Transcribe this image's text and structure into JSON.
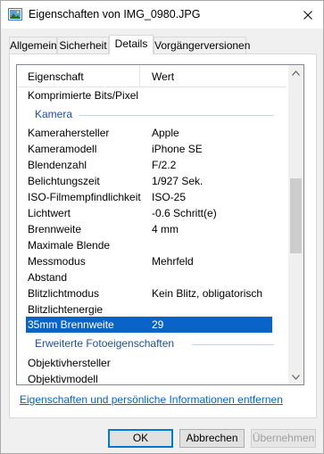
{
  "window": {
    "title": "Eigenschaften von IMG_0980.JPG",
    "close_icon": "close-icon"
  },
  "tabs": [
    {
      "label": "Allgemein",
      "active": false
    },
    {
      "label": "Sicherheit",
      "active": false
    },
    {
      "label": "Details",
      "active": true
    },
    {
      "label": "Vorgängerversionen",
      "active": false
    }
  ],
  "list": {
    "header": {
      "property": "Eigenschaft",
      "value": "Wert"
    },
    "rows": [
      {
        "type": "row",
        "property": "Komprimierte Bits/Pixel",
        "value": ""
      },
      {
        "type": "group",
        "label": "Kamera"
      },
      {
        "type": "row",
        "property": "Kamerahersteller",
        "value": "Apple"
      },
      {
        "type": "row",
        "property": "Kameramodell",
        "value": "iPhone SE"
      },
      {
        "type": "row",
        "property": "Blendenzahl",
        "value": "F/2.2"
      },
      {
        "type": "row",
        "property": "Belichtungszeit",
        "value": "1/927 Sek."
      },
      {
        "type": "row",
        "property": "ISO-Filmempfindlichkeit",
        "value": "ISO-25"
      },
      {
        "type": "row",
        "property": "Lichtwert",
        "value": "-0.6 Schritt(e)"
      },
      {
        "type": "row",
        "property": "Brennweite",
        "value": "4 mm"
      },
      {
        "type": "row",
        "property": "Maximale Blende",
        "value": ""
      },
      {
        "type": "row",
        "property": "Messmodus",
        "value": "Mehrfeld"
      },
      {
        "type": "row",
        "property": "Abstand",
        "value": ""
      },
      {
        "type": "row",
        "property": "Blitzlichtmodus",
        "value": "Kein Blitz, obligatorisch"
      },
      {
        "type": "row",
        "property": "Blitzlichtenergie",
        "value": ""
      },
      {
        "type": "row",
        "property": "35mm Brennweite",
        "value": "29",
        "selected": true
      },
      {
        "type": "group",
        "label": "Erweiterte Fotoeigenschaften"
      },
      {
        "type": "row",
        "property": "Objektivhersteller",
        "value": ""
      },
      {
        "type": "row",
        "property": "Objektivmodell",
        "value": ""
      }
    ]
  },
  "remove_link": "Eigenschaften und persönliche Informationen entfernen",
  "buttons": {
    "ok": "OK",
    "cancel": "Abbrechen",
    "apply": "Übernehmen"
  },
  "colors": {
    "selection": "#0a64c8",
    "group_text": "#1e4e9d",
    "link": "#0066cc"
  }
}
